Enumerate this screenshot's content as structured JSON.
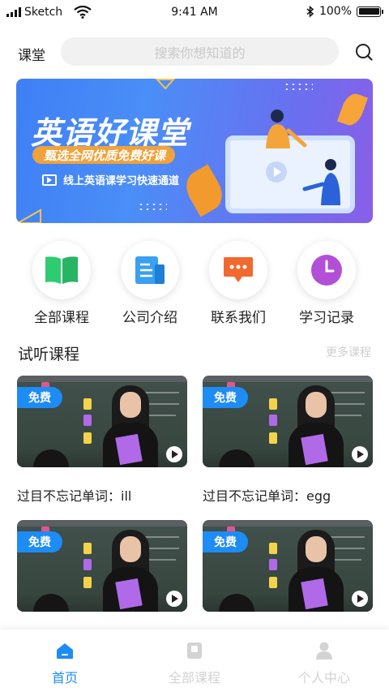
{
  "status_bar": {
    "carrier": "Sketch",
    "time": "9:41 AM",
    "battery": "100%",
    "battery_level": 1.0
  },
  "header": {
    "title": "课堂",
    "search_placeholder": "搜索你想知道的",
    "search_icon": "search-icon"
  },
  "banner": {
    "title": "英语好课堂",
    "subtitle": "甄选全网优质免费好课",
    "tagline": "线上英语课学习快速通道",
    "colors": {
      "gradient_start": "#3f7ff5",
      "gradient_end": "#8a5ee8",
      "pill": "#f0a23b"
    }
  },
  "nav": {
    "items": [
      {
        "label": "全部课程",
        "icon": "book-icon",
        "color": "#2ecc71"
      },
      {
        "label": "公司介绍",
        "icon": "document-icon",
        "color": "#3aa0f0"
      },
      {
        "label": "联系我们",
        "icon": "chat-icon",
        "color": "#f2692f"
      },
      {
        "label": "学习记录",
        "icon": "clock-icon",
        "color": "#b34fd6"
      }
    ]
  },
  "section": {
    "title": "试听课程",
    "more": "更多课程"
  },
  "courses": [
    {
      "badge": "免费",
      "title": "过目不忘记单词：ill"
    },
    {
      "badge": "免费",
      "title": "过目不忘记单词：egg"
    },
    {
      "badge": "免费",
      "title": ""
    },
    {
      "badge": "免费",
      "title": ""
    }
  ],
  "tabbar": {
    "items": [
      {
        "label": "首页",
        "icon": "home-icon",
        "active": true
      },
      {
        "label": "全部课程",
        "icon": "book-icon",
        "active": false
      },
      {
        "label": "个人中心",
        "icon": "user-icon",
        "active": false
      }
    ],
    "active_color": "#1e8cf5",
    "inactive_color": "#d3d3d3"
  }
}
